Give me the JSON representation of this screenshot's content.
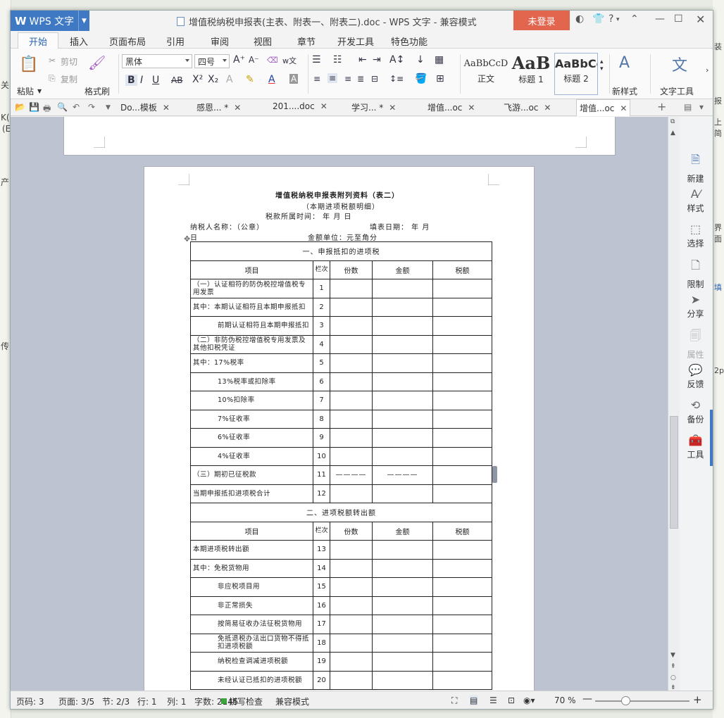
{
  "background": {
    "left_fragments": [
      "关",
      "K(",
      "(E",
      "产",
      "传"
    ],
    "right_fragments": [
      "装",
      "报",
      "上简",
      "界面",
      "填",
      "2p"
    ]
  },
  "titlebar": {
    "app_name": "WPS 文字",
    "doc_title": "增值税纳税申报表(主表、附表一、附表二).doc - WPS 文字 - 兼容模式",
    "login_label": "未登录",
    "help_label": "?"
  },
  "menu": {
    "tabs": [
      "开始",
      "插入",
      "页面布局",
      "引用",
      "审阅",
      "视图",
      "章节",
      "开发工具",
      "特色功能"
    ]
  },
  "ribbon": {
    "paste": "粘贴",
    "cut": "剪切",
    "copy": "复制",
    "format_painter": "格式刷",
    "font_name": "黑体",
    "font_size": "四号",
    "phonetic": "w文",
    "styles": [
      {
        "preview": "AaBbCcD",
        "label": "正文"
      },
      {
        "preview": "AaB",
        "label": "标题 1"
      },
      {
        "preview": "AaBbCc",
        "label": "标题 2"
      }
    ],
    "new_style": "新样式",
    "text_tools": "文字工具"
  },
  "doc_tabs": [
    {
      "label": "Do...模板"
    },
    {
      "label": "感恩... *"
    },
    {
      "label": "201....doc"
    },
    {
      "label": "学习... *"
    },
    {
      "label": "增值...oc"
    },
    {
      "label": "飞游...oc"
    },
    {
      "label": "增值...oc"
    }
  ],
  "document": {
    "title": "增值税纳税申报表附列资料（表二）",
    "subtitle": "（本期进项税额明细）",
    "period_line": "税款所属时间：      年    月    日",
    "taxpayer_label": "纳税人名称：（公章）",
    "fill_date": "填表日期：          年    月",
    "day_frag": "日",
    "unit_line": "金额单位：元至角分",
    "section1": "一、申报抵扣的进项税",
    "section2": "二、进项税额转出额",
    "header": [
      "项目",
      "栏次",
      "份数",
      "金额",
      "税额"
    ],
    "rows1": [
      {
        "item": "（一）认证相符的防伪税控增值税专用发票",
        "no": "1",
        "indent": false
      },
      {
        "item": "其中：本期认证相符且本期申报抵扣",
        "no": "2",
        "indent": false
      },
      {
        "item": "前期认证相符且本期申报抵扣",
        "no": "3",
        "indent": true
      },
      {
        "item": "（二）非防伪税控增值税专用发票及其他扣税凭证",
        "no": "4",
        "indent": false
      },
      {
        "item": "其中：17%税率",
        "no": "5",
        "indent": false
      },
      {
        "item": "13%税率或扣除率",
        "no": "6",
        "indent": true
      },
      {
        "item": "10%扣除率",
        "no": "7",
        "indent": true
      },
      {
        "item": "7%征收率",
        "no": "8",
        "indent": true
      },
      {
        "item": "6%征收率",
        "no": "9",
        "indent": true
      },
      {
        "item": "4%征收率",
        "no": "10",
        "indent": true
      },
      {
        "item": "（三）期初已征税款",
        "no": "11",
        "indent": false,
        "dash": "————"
      },
      {
        "item": "当期申报抵扣进项税合计",
        "no": "12",
        "indent": false
      }
    ],
    "rows2": [
      {
        "item": "本期进项税转出额",
        "no": "13",
        "indent": false
      },
      {
        "item": "其中：免税货物用",
        "no": "14",
        "indent": false
      },
      {
        "item": "非应税项目用",
        "no": "15",
        "indent": true
      },
      {
        "item": "非正常损失",
        "no": "16",
        "indent": true
      },
      {
        "item": "按简易征收办法征税货物用",
        "no": "17",
        "indent": true
      },
      {
        "item": "免抵退税办法出口货物不得抵扣进项税额",
        "no": "18",
        "indent": true
      },
      {
        "item": "纳税检查调减进项税额",
        "no": "19",
        "indent": true
      },
      {
        "item": "未经认证已抵扣的进项税额",
        "no": "20",
        "indent": true
      }
    ]
  },
  "side_panel": [
    {
      "label": "新建",
      "icon": "new-doc-icon"
    },
    {
      "label": "样式",
      "icon": "style-icon"
    },
    {
      "label": "选择",
      "icon": "select-icon"
    },
    {
      "label": "限制",
      "icon": "restrict-icon"
    },
    {
      "label": "分享",
      "icon": "share-icon"
    },
    {
      "label": "属性",
      "icon": "properties-icon"
    },
    {
      "label": "反馈",
      "icon": "feedback-icon"
    },
    {
      "label": "备份",
      "icon": "backup-icon"
    },
    {
      "label": "工具",
      "icon": "toolbox-icon"
    }
  ],
  "status": {
    "page_code": "页码: 3",
    "pages": "页面: 3/5",
    "section": "节: 2/3",
    "row": "行: 1",
    "col": "列: 1",
    "words": "字数: 2145",
    "spell": "拼写检查",
    "mode": "兼容模式",
    "zoom": "70 %"
  },
  "colors": {
    "accent": "#3f78c3",
    "login": "#e2664e",
    "workspace": "#bdc3d0"
  }
}
